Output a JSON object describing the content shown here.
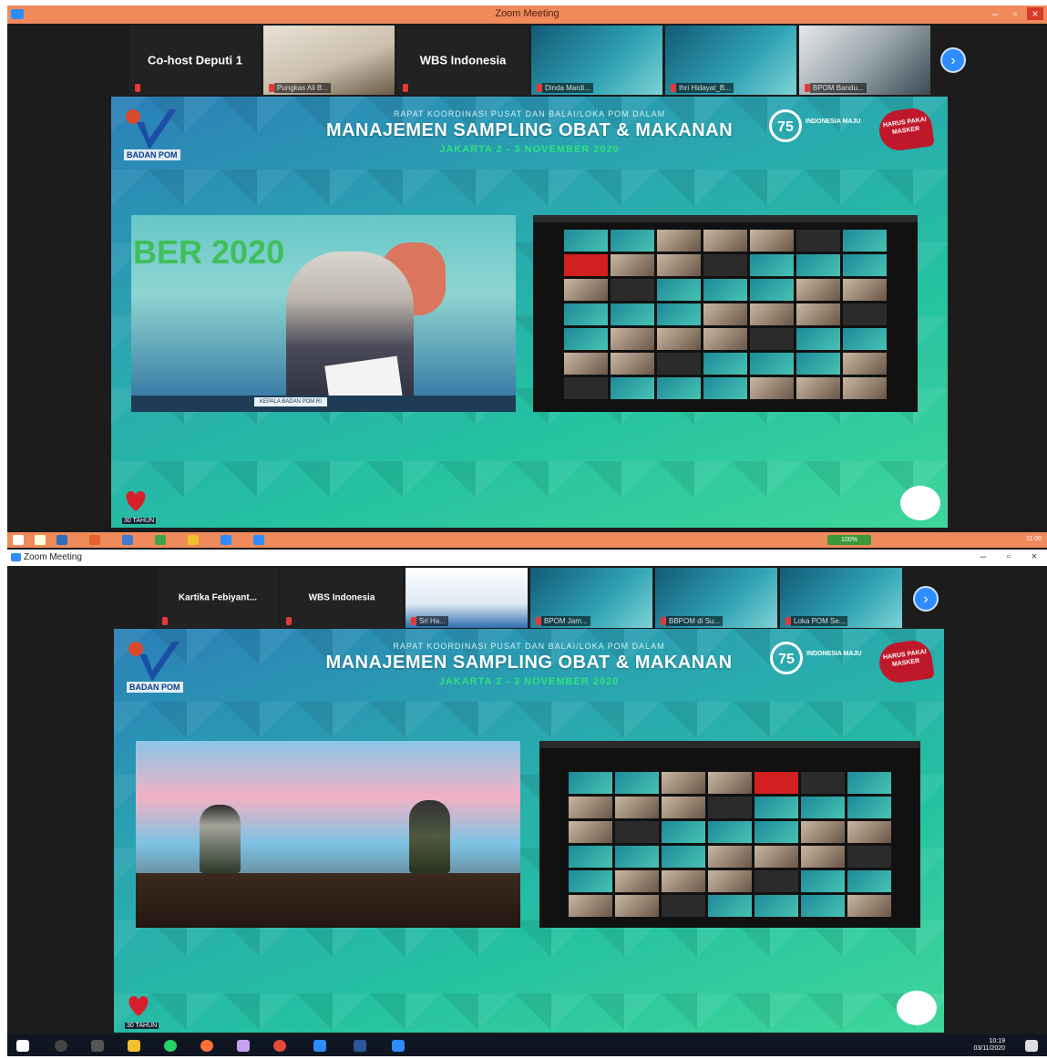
{
  "shot1": {
    "window_title": "Zoom Meeting",
    "participants": [
      {
        "name": "Co-host Deputi 1",
        "type": "name"
      },
      {
        "name": "Pungkas Ali B...",
        "type": "video",
        "style": "vid-face"
      },
      {
        "name": "WBS Indonesia",
        "type": "name"
      },
      {
        "name": "Dinda Mardi...",
        "type": "video",
        "style": "vid-ocean"
      },
      {
        "name": "Ihri Hidayat_B...",
        "type": "video",
        "style": "vid-ocean"
      },
      {
        "name": "BPOM Bandu...",
        "type": "video",
        "style": "vid-room"
      }
    ],
    "next_icon": "chevron-right-icon",
    "tray_percent": "100%",
    "tray_time": "11:00"
  },
  "shot2": {
    "window_title": "Zoom Meeting",
    "participants": [
      {
        "name": "Kartika Febiyant...",
        "type": "name"
      },
      {
        "name": "WBS Indonesia",
        "type": "name"
      },
      {
        "name": "Sri Ha...",
        "type": "video",
        "style": "vid-slide"
      },
      {
        "name": "BPOM Jam...",
        "type": "video",
        "style": "vid-ocean"
      },
      {
        "name": "BBPOM di Su...",
        "type": "video",
        "style": "vid-ocean"
      },
      {
        "name": "Loka POM Se...",
        "type": "video",
        "style": "vid-ocean"
      }
    ],
    "next_icon": "chevron-right-icon",
    "tray_time": "10:19",
    "tray_date": "03/11/2020"
  },
  "slide": {
    "subtitle": "RAPAT KOORDINASI PUSAT DAN BALAI/LOKA POM DALAM",
    "title": "MANAJEMEN SAMPLING OBAT & MAKANAN",
    "date": "JAKARTA    2 - 3 NOVEMBER 2020",
    "agency": "BADAN POM",
    "badge": "75",
    "badge_caption": "INDONESIA MAJU",
    "campaign": "HARUS PAKAI MASKER",
    "bottom_left": "30 TAHUN",
    "banner_text": "BER 2020",
    "speaker_caption": "KEPALA BADAN POM RI"
  },
  "colors": {
    "zoom_blue": "#2d8cff",
    "title_orange": "#f08a5b",
    "mic_red": "#e53935",
    "slide_green": "#2fe27c",
    "taskbar_dark": "#101621"
  }
}
